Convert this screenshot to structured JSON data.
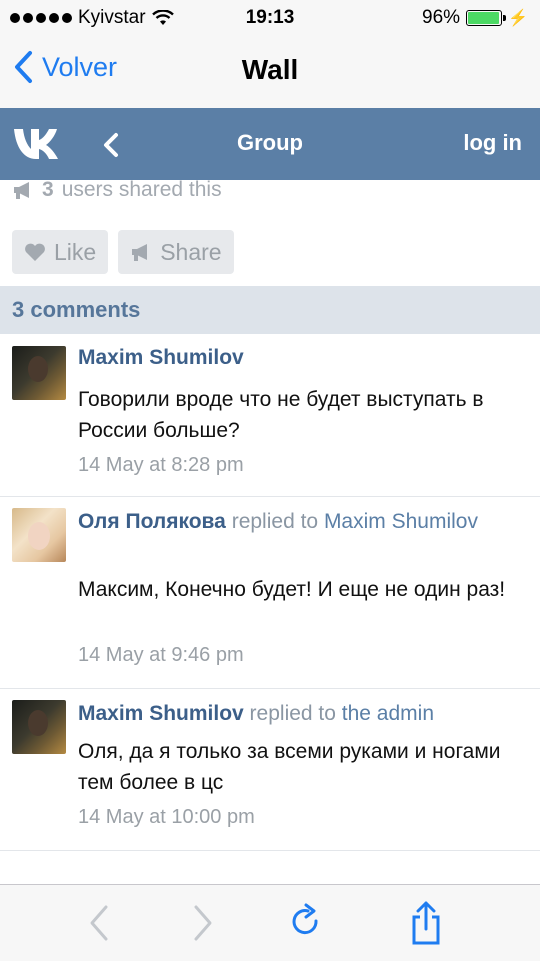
{
  "status_bar": {
    "carrier": "Kyivstar",
    "time": "19:13",
    "battery": "96%",
    "battery_level": 0.96
  },
  "ios_nav": {
    "back_label": "Volver",
    "title": "Wall"
  },
  "vk_header": {
    "logo": "vk-logo",
    "title": "Group",
    "login_label": "log in"
  },
  "post": {
    "shared_count": "3",
    "shared_text": "users shared this",
    "like_label": "Like",
    "share_label": "Share"
  },
  "comments_header": "3 comments",
  "comments": [
    {
      "author": "Maxim Shumilov",
      "replied": "",
      "target": "",
      "text": "Говорили вроде что не будет выступать в России больше?",
      "time": "14 May at 8:28 pm"
    },
    {
      "author": "Оля Полякова",
      "replied": "replied to",
      "target": "Maxim Shumilov",
      "text": "Максим, Конечно будет! И еще не один раз!",
      "time": "14 May at 9:46 pm"
    },
    {
      "author": "Maxim Shumilov",
      "replied": "replied to",
      "target": "the admin",
      "text": "Оля, да я только за всеми руками и ногами тем более в цс",
      "time": "14 May at 10:00 pm"
    }
  ],
  "colors": {
    "vk_blue": "#5b7fa6",
    "ios_blue": "#1f7cf0",
    "battery_green": "#4cd964"
  }
}
